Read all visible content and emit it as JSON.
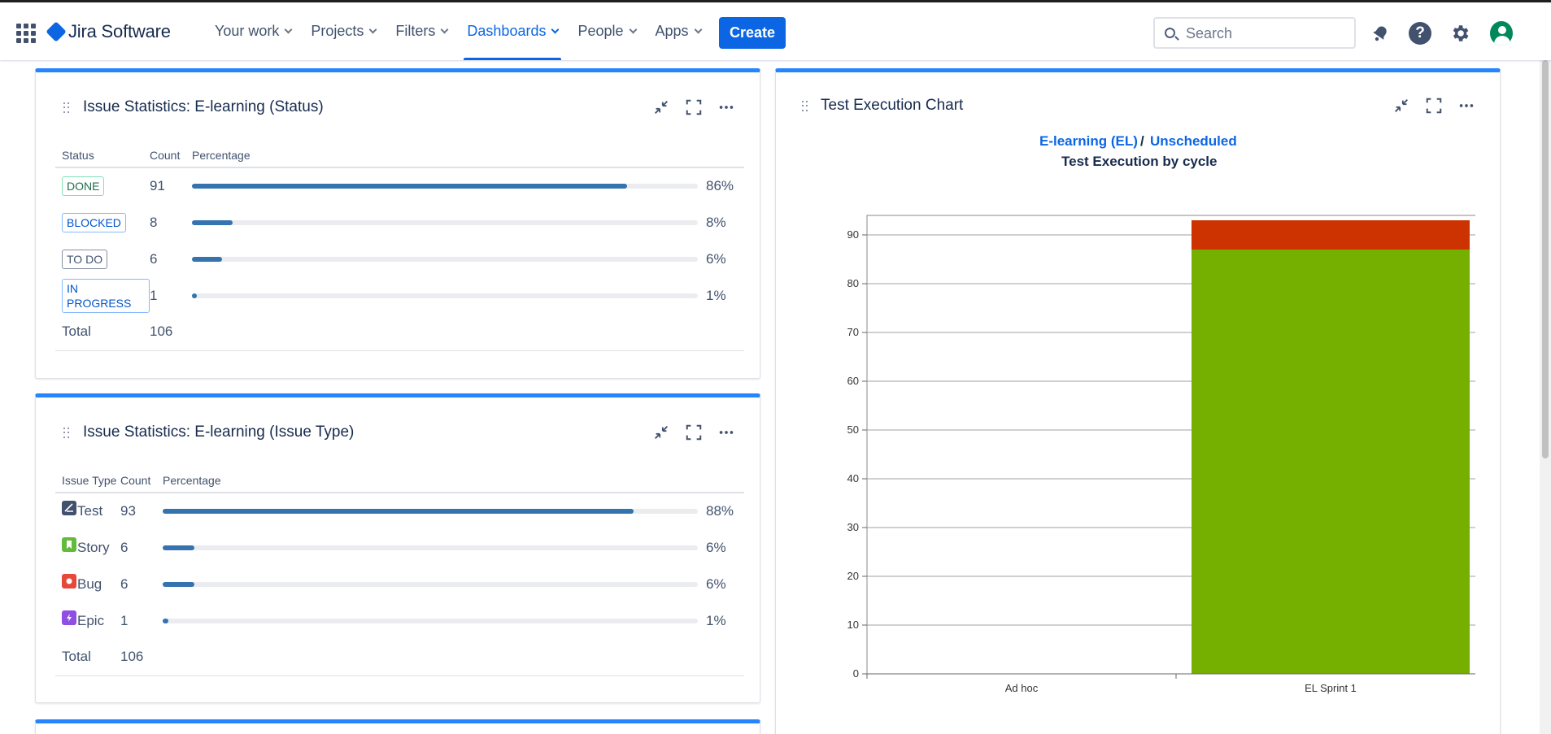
{
  "topbar": {
    "product_name": "Jira Software",
    "nav": [
      {
        "label": "Your work",
        "active": false
      },
      {
        "label": "Projects",
        "active": false
      },
      {
        "label": "Filters",
        "active": false
      },
      {
        "label": "Dashboards",
        "active": true
      },
      {
        "label": "People",
        "active": false
      },
      {
        "label": "Apps",
        "active": false
      }
    ],
    "create_label": "Create",
    "search_placeholder": "Search",
    "icons": [
      "app-switcher-icon",
      "notifications-icon",
      "help-icon",
      "settings-icon",
      "avatar"
    ],
    "accent_color": "#0c66e4"
  },
  "status_gadget": {
    "title": "Issue Statistics: E-learning (Status)",
    "headers": [
      "Status",
      "Count",
      "Percentage"
    ],
    "rows": [
      {
        "label": "DONE",
        "count": "91",
        "pct": "86%",
        "fraction": 0.86,
        "style": "green"
      },
      {
        "label": "BLOCKED",
        "count": "8",
        "pct": "8%",
        "fraction": 0.08,
        "style": "blue"
      },
      {
        "label": "TO DO",
        "count": "6",
        "pct": "6%",
        "fraction": 0.06,
        "style": "grey"
      },
      {
        "label": "IN PROGRESS",
        "count": "1",
        "pct": "1%",
        "fraction": 0.01,
        "style": "blue"
      }
    ],
    "total_label": "Total",
    "total_count": "106"
  },
  "type_gadget": {
    "title": "Issue Statistics: E-learning (Issue Type)",
    "headers": [
      "Issue Type",
      "Count",
      "Percentage"
    ],
    "rows": [
      {
        "label": "Test",
        "count": "93",
        "pct": "88%",
        "fraction": 0.88,
        "icon": "test-icon",
        "color": "#42526e"
      },
      {
        "label": "Story",
        "count": "6",
        "pct": "6%",
        "fraction": 0.06,
        "icon": "story-icon",
        "color": "#63ba3c"
      },
      {
        "label": "Bug",
        "count": "6",
        "pct": "6%",
        "fraction": 0.06,
        "icon": "bug-icon",
        "color": "#e5493a"
      },
      {
        "label": "Epic",
        "count": "1",
        "pct": "1%",
        "fraction": 0.01,
        "icon": "epic-icon",
        "color": "#904ee2"
      }
    ],
    "total_label": "Total",
    "total_count": "106"
  },
  "test_chart": {
    "title": "Test Execution Chart",
    "project_link": "E-learning (EL)",
    "separator": "/",
    "version_link": "Unscheduled",
    "subtitle": "Test Execution by cycle"
  },
  "chart_data": {
    "type": "bar",
    "stacked": true,
    "categories": [
      "Ad hoc",
      "EL Sprint 1"
    ],
    "series": [
      {
        "values": [
          0,
          87
        ],
        "color": "#75b000"
      },
      {
        "values": [
          0,
          6
        ],
        "color": "#cc3300"
      }
    ],
    "ylim": [
      0,
      94
    ],
    "yticks": [
      0,
      10,
      20,
      30,
      40,
      50,
      60,
      70,
      80,
      90
    ],
    "grid": true
  }
}
